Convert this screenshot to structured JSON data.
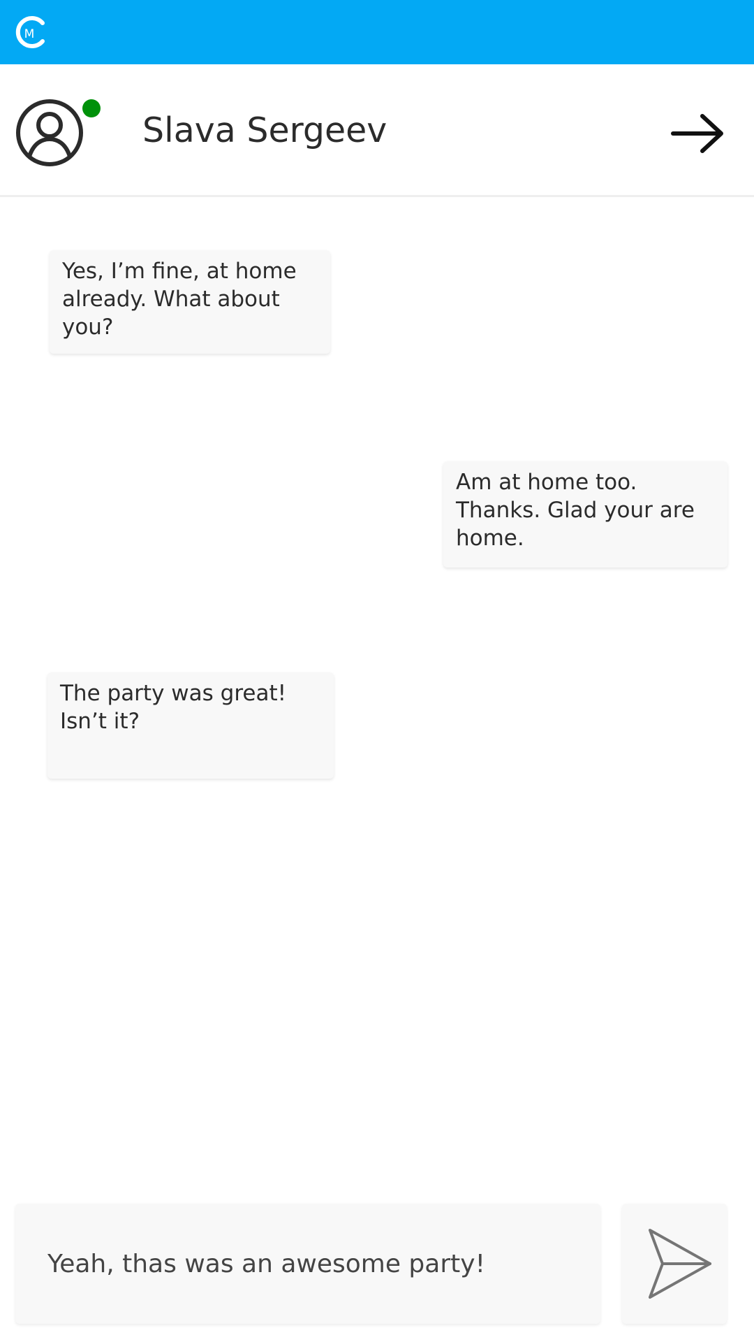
{
  "app": {
    "logo_letter": "M",
    "brand_color": "#03a9f4"
  },
  "header": {
    "contact_name": "Slava Sergeev",
    "status": "online",
    "status_color": "#00910a",
    "avatar_icon": "user-circle-icon",
    "action_icon": "arrow-right-icon"
  },
  "messages": [
    {
      "side": "left",
      "text": "Yes, I’m fine, at home\nalready. What about\nyou?"
    },
    {
      "side": "right",
      "text": "Am at home too.\nThanks. Glad your are\nhome."
    },
    {
      "side": "left",
      "text": "The party was great!\nIsn’t it?"
    }
  ],
  "composer": {
    "value": "Yeah, thas was an awesome party!",
    "send_icon": "send-icon"
  }
}
